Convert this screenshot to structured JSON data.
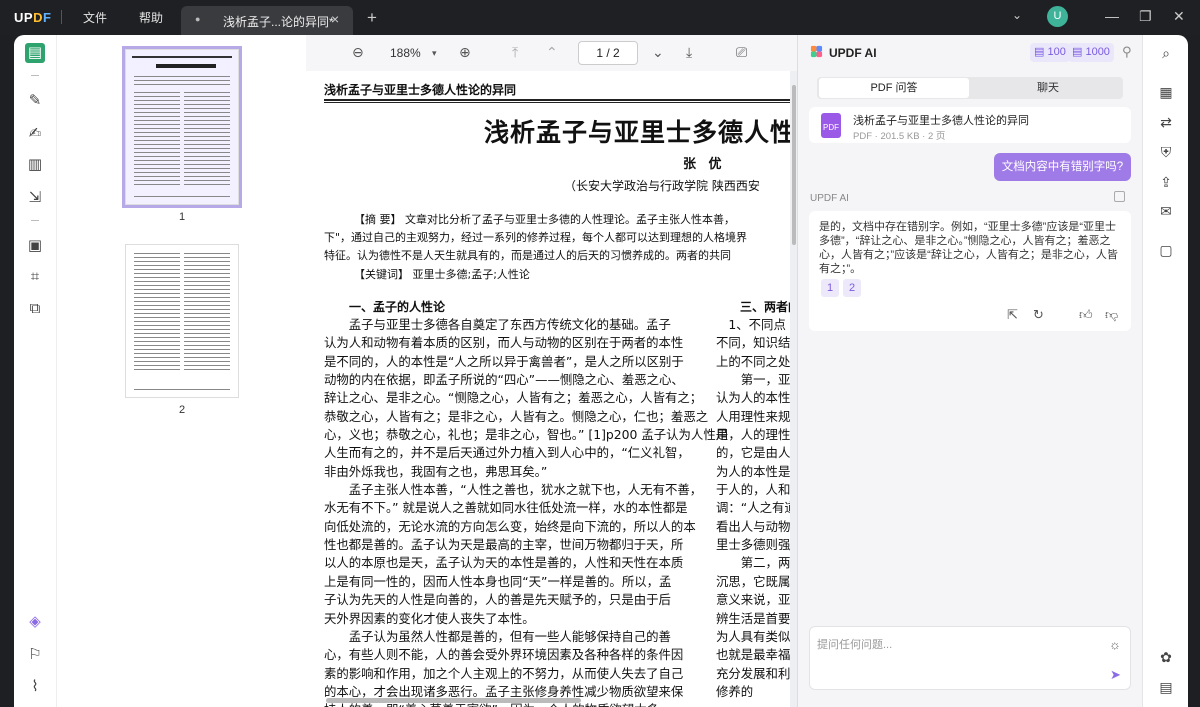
{
  "app": {
    "logo": "UPDF",
    "menu_file": "文件",
    "menu_help": "帮助"
  },
  "tab": {
    "title": "浅析孟子...论的异同*",
    "close": "×",
    "new": "+"
  },
  "avatar": "U",
  "thumbs": {
    "p1": "1",
    "p2": "2"
  },
  "toolbar": {
    "zoom": "188%",
    "page": "1 / 2"
  },
  "doc": {
    "header": "浅析孟子与亚里士多德人性论的异同",
    "title": "浅析孟子与亚里士多德人性",
    "author": "张  优",
    "affil": "（长安大学政治与行政学院  陕西西安",
    "abs1": "【摘  要】 文章对比分析了孟子与亚里士多德的人性理论。孟子主张人性本善，",
    "abs2": "下\"，通过自己的主观努力，经过一系列的修养过程，每个人都可以达到理想的人格境界",
    "abs3": "特征。认为德性不是人天生就具有的，而是通过人的后天的习惯养成的。两者的共同",
    "kw": "【关键词】 亚里士多德;孟子;人性论",
    "sec1": "一、孟子的人性论",
    "sec3": "三、两者的",
    "col1": [
      "　　孟子与亚里士多德各自奠定了东西方传统文化的基础。孟子",
      "认为人和动物有着本质的区别，而人与动物的区别在于两者的本性",
      "是不同的，人的本性是“人之所以异于禽兽者”，是人之所以区别于",
      "动物的内在依据，即孟子所说的“四心”——恻隐之心、羞恶之心、",
      "辞让之心、是非之心。“恻隐之心，人皆有之；羞恶之心，人皆有之；",
      "恭敬之心，人皆有之；是非之心，人皆有之。恻隐之心，仁也；羞恶之",
      "心，义也；恭敬之心，礼也；是非之心，智也。” [1]p200 孟子认为人性是",
      "人生而有之的，并不是后天通过外力植入到人心中的，“仁义礼智，",
      "非由外烁我也，我固有之也，弗思耳矣。”",
      "　　孟子主张人性本善，“人性之善也，犹水之就下也，人无有不善，",
      "水无有不下。” 就是说人之善就如同水往低处流一样，水的本性都是",
      "向低处流的，无论水流的方向怎么变，始终是向下流的，所以人的本",
      "性也都是善的。孟子认为天是最高的主宰，世间万物都归于天，所",
      "以人的本原也是天，孟子认为天的本性是善的，人性和天性在本质",
      "上是有同一性的，因而人性本身也同“天”一样是善的。所以，孟",
      "子认为先天的人性是向善的，人的善是先天赋予的，只是由于后",
      "天外界因素的变化才使人丧失了本性。",
      "　　孟子认为虽然人性都是善的，但有一些人能够保持自己的善",
      "心，有些人则不能，人的善会受外界环境因素及各种各样的条件因",
      "素的影响和作用，加之个人主观上的不努力，从而使人失去了自己",
      "的本心，才会出现诸多恶行。孟子主张修身养性减少物质欲望来保",
      "持人的善，即“养心莫善于寡欲”。因为一个人的物质欲望太多"
    ],
    "col2": [
      "　1、不同点",
      "不同，知识结",
      "上的不同之处",
      "　　第一，亚里",
      "认为人的本性",
      "人用理性来规",
      "用，人的理性",
      "的，它是由人",
      "为人的本性是",
      "于人的，人和",
      "调：“人之有道",
      "看出人与动物",
      "里士多德则强",
      "　　第二，两",
      "沉思，它既属",
      "意义来说，亚里",
      "辨生活是首要",
      "为人具有类似",
      "也就是最幸福",
      "充分发展和利",
      "修养的"
    ]
  },
  "ai": {
    "title": "UPDF AI",
    "credit1": "100",
    "credit2": "1000",
    "tab_pdf": "PDF 问答",
    "tab_chat": "聊天",
    "file_name": "浅析孟子与亚里士多德人性论的异同",
    "file_meta": "PDF · 201.5 KB · 2 页",
    "pdf_label": "PDF",
    "user_question": "文档内容中有错别字吗?",
    "ai_label": "UPDF AI",
    "answer": "是的，文档中存在错别字。例如，“亚里士多德”应该是“亚里士多德”，“辞让之心、是非之心。”恻隐之心，人皆有之；羞恶之心，人皆有之；”应该是“辞让之心，人皆有之；是非之心，人皆有之；”。",
    "ref1": "1",
    "ref2": "2",
    "placeholder": "提问任何问题..."
  }
}
